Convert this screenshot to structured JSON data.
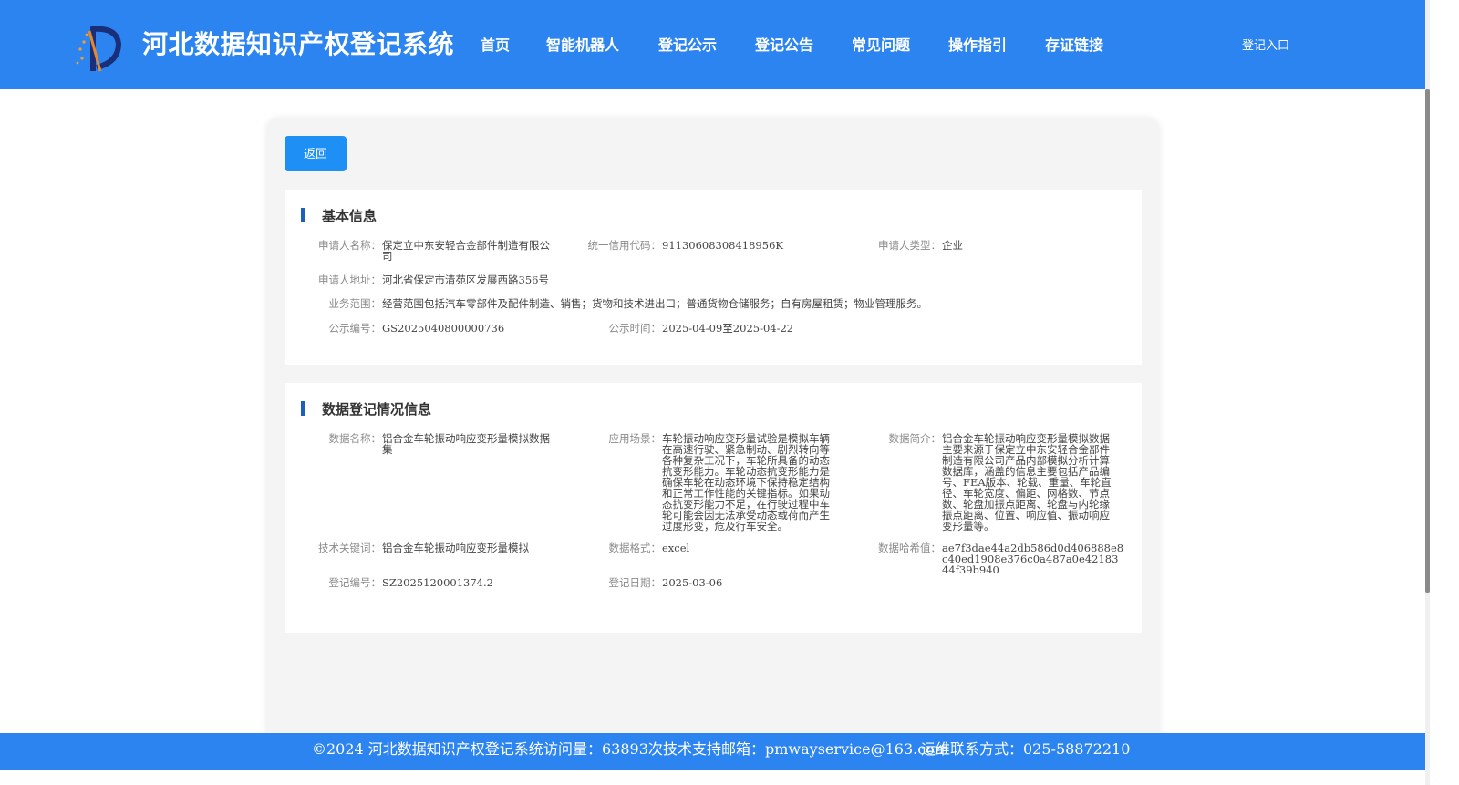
{
  "header": {
    "title": "河北数据知识产权登记系统",
    "nav": [
      "首页",
      "智能机器人",
      "登记公示",
      "登记公告",
      "常见问题",
      "操作指引",
      "存证链接"
    ],
    "login": "登记入口"
  },
  "back_label": "返回",
  "basic_info": {
    "section_title": "基本信息",
    "applicant_name_label": "申请人名称：",
    "applicant_name": "保定立中东安轻合金部件制造有限公司",
    "credit_code_label": "统一信用代码：",
    "credit_code": "91130608308418956K",
    "applicant_type_label": "申请人类型：",
    "applicant_type": "企业",
    "address_label": "申请人地址：",
    "address": "河北省保定市清苑区发展西路356号",
    "scope_label": "业务范围：",
    "scope": "经营范围包括汽车零部件及配件制造、销售；货物和技术进出口；普通货物仓储服务；自有房屋租赁；物业管理服务。",
    "notice_no_label": "公示编号：",
    "notice_no": "GS2025040800000736",
    "notice_time_label": "公示时间：",
    "notice_time": "2025-04-09至2025-04-22"
  },
  "data_info": {
    "section_title": "数据登记情况信息",
    "data_name_label": "数据名称：",
    "data_name": "铝合金车轮振动响应变形量模拟数据集",
    "scenario_label": "应用场景：",
    "scenario": "车轮振动响应变形量试验是模拟车辆在高速行驶、紧急制动、剧烈转向等各种复杂工况下，车轮所具备的动态抗变形能力。车轮动态抗变形能力是确保车轮在动态环境下保持稳定结构和正常工作性能的关键指标。如果动态抗变形能力不足，在行驶过程中车轮可能会因无法承受动态载荷而产生过度形变，危及行车安全。",
    "intro_label": "数据简介：",
    "intro": "铝合金车轮振动响应变形量模拟数据主要来源于保定立中东安轻合金部件制造有限公司产品内部模拟分析计算数据库，涵盖的信息主要包括产品编号、FEA版本、轮载、重量、车轮直径、车轮宽度、偏距、网格数、节点数、轮盘加振点距离、轮盘与内轮缘振点距离、位置、响应值、振动响应变形量等。",
    "keywords_label": "技术关键词：",
    "keywords": "铝合金车轮振动响应变形量模拟",
    "format_label": "数据格式：",
    "format": "excel",
    "hash_label": "数据哈希值：",
    "hash": "ae7f3dae44a2db586d0d406888e8c40ed1908e376c0a487a0e4218344f39b940",
    "reg_no_label": "登记编号：",
    "reg_no": "SZ2025120001374.2",
    "reg_date_label": "登记日期：",
    "reg_date": "2025-03-06"
  },
  "footer": {
    "copyright": "©2024 河北数据知识产权登记系统",
    "visits": "访问量：63893次",
    "email": "技术支持邮箱：pmwayservice@163.com",
    "phone": "运维联系方式：025-58872210"
  },
  "colors": {
    "header_bg": "#2b84f0",
    "button_bg": "#1e90f5",
    "section_accent": "#1d5fbf"
  }
}
